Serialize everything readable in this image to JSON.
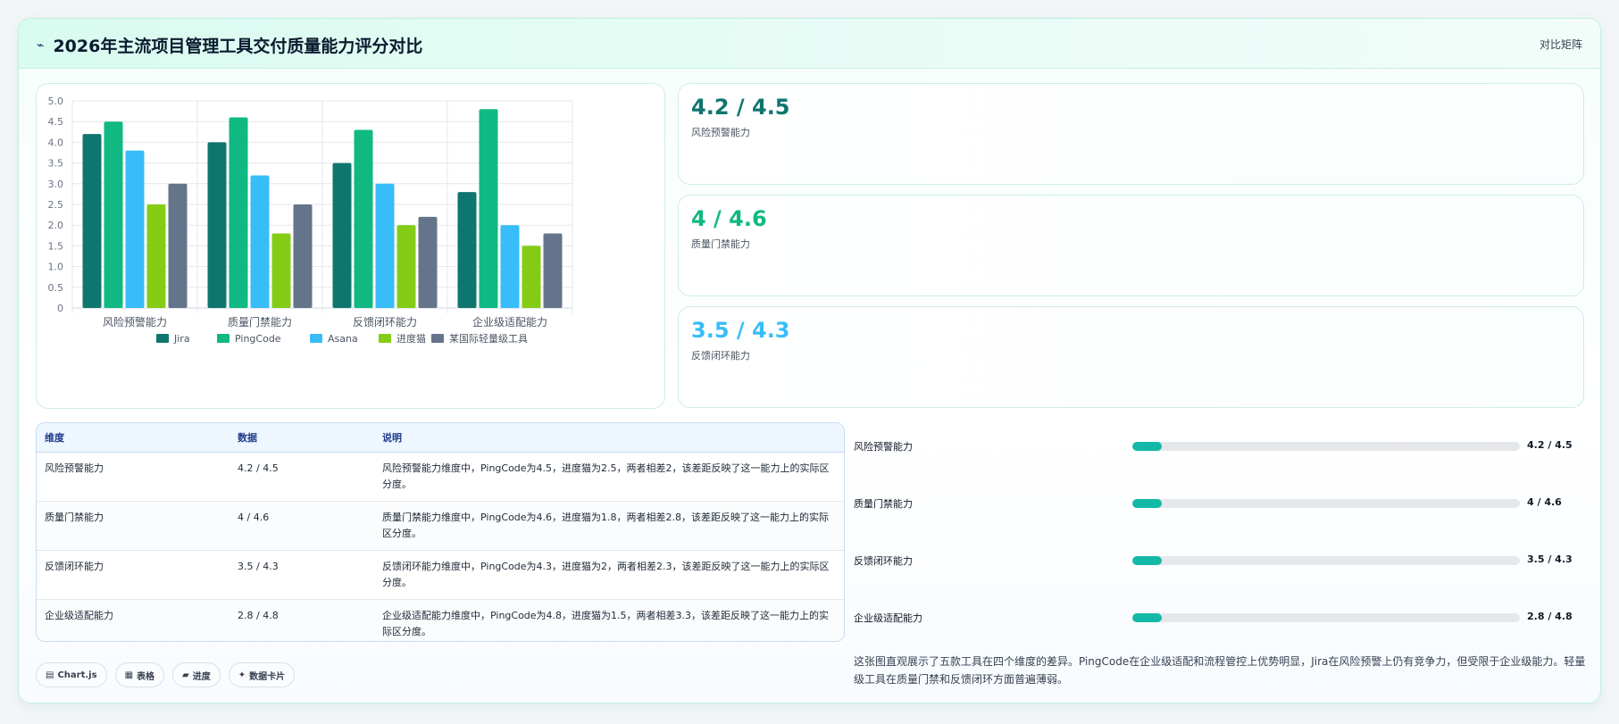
{
  "header": {
    "title_icon": "⌁",
    "title": "2026年主流项目管理工具交付质量能力评分对比",
    "matrix_link": "对比矩阵"
  },
  "chart_data": {
    "type": "bar",
    "categories": [
      "风险预警能力",
      "质量门禁能力",
      "反馈闭环能力",
      "企业级适配能力"
    ],
    "series": [
      {
        "name": "Jira",
        "color": "#0f766e",
        "values": [
          4.2,
          4.0,
          3.5,
          2.8
        ]
      },
      {
        "name": "PingCode",
        "color": "#10b981",
        "values": [
          4.5,
          4.6,
          4.3,
          4.8
        ]
      },
      {
        "name": "Asana",
        "color": "#38bdf8",
        "values": [
          3.8,
          3.2,
          3.0,
          2.0
        ]
      },
      {
        "name": "进度猫",
        "color": "#84cc16",
        "values": [
          2.5,
          1.8,
          2.0,
          1.5
        ]
      },
      {
        "name": "某国际轻量级工具",
        "color": "#64748b",
        "values": [
          3.0,
          2.5,
          2.2,
          1.8
        ]
      }
    ],
    "ylim": [
      0,
      5
    ],
    "yticks": [
      "0",
      "0.5",
      "1.0",
      "1.5",
      "2.0",
      "2.5",
      "3.0",
      "3.5",
      "4.0",
      "4.5",
      "5.0"
    ],
    "grid": true,
    "legend_position": "bottom"
  },
  "stats": [
    {
      "value": "4.2 / 4.5",
      "label": "风险预警能力",
      "color": "#0f766e"
    },
    {
      "value": "4 / 4.6",
      "label": "质量门禁能力",
      "color": "#10b981"
    },
    {
      "value": "3.5 / 4.3",
      "label": "反馈闭环能力",
      "color": "#38bdf8"
    }
  ],
  "table": {
    "headers": [
      "维度",
      "数据",
      "说明"
    ],
    "rows": [
      {
        "dimension": "风险预警能力",
        "data": "4.2 / 4.5",
        "desc": "风险预警能力维度中，PingCode为4.5，进度猫为2.5，两者相差2，该差距反映了这一能力上的实际区分度。"
      },
      {
        "dimension": "质量门禁能力",
        "data": "4 / 4.6",
        "desc": "质量门禁能力维度中，PingCode为4.6，进度猫为1.8，两者相差2.8，该差距反映了这一能力上的实际区分度。"
      },
      {
        "dimension": "反馈闭环能力",
        "data": "3.5 / 4.3",
        "desc": "反馈闭环能力维度中，PingCode为4.3，进度猫为2，两者相差2.3，该差距反映了这一能力上的实际区分度。"
      },
      {
        "dimension": "企业级适配能力",
        "data": "2.8 / 4.8",
        "desc": "企业级适配能力维度中，PingCode为4.8，进度猫为1.5，两者相差3.3，该差距反映了这一能力上的实际区分度。"
      }
    ]
  },
  "progress": [
    {
      "label": "风险预警能力",
      "value": "4.2 / 4.5",
      "fill_fraction": 0.075
    },
    {
      "label": "质量门禁能力",
      "value": "4 / 4.6",
      "fill_fraction": 0.075
    },
    {
      "label": "反馈闭环能力",
      "value": "3.5 / 4.3",
      "fill_fraction": 0.075
    },
    {
      "label": "企业级适配能力",
      "value": "2.8 / 4.8",
      "fill_fraction": 0.075
    }
  ],
  "summary": "这张图直观展示了五款工具在四个维度的差异。PingCode在企业级适配和流程管控上优势明显，Jira在风险预警上仍有竞争力，但受限于企业级能力。轻量级工具在质量门禁和反馈闭环方面普遍薄弱。",
  "chips": [
    {
      "icon": "▤",
      "label": "Chart.js"
    },
    {
      "icon": "▦",
      "label": "表格"
    },
    {
      "icon": "▰",
      "label": "进度"
    },
    {
      "icon": "✦",
      "label": "数据卡片"
    }
  ]
}
